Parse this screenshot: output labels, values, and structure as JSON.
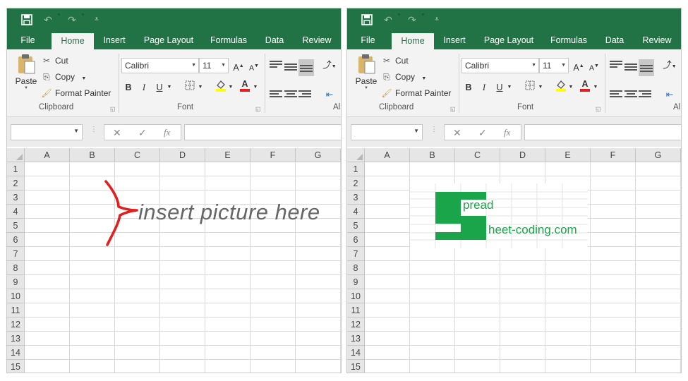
{
  "ribbon": {
    "tabs": [
      "File",
      "Home",
      "Insert",
      "Page Layout",
      "Formulas",
      "Data",
      "Review"
    ],
    "active_tab": "Home",
    "clipboard": {
      "paste": "Paste",
      "cut": "Cut",
      "copy": "Copy",
      "format_painter": "Format Painter",
      "group_label": "Clipboard"
    },
    "font": {
      "name": "Calibri",
      "size": "11",
      "group_label": "Font",
      "bold": "B",
      "italic": "I",
      "underline": "U",
      "grow": "A",
      "shrink": "A",
      "color": "A"
    },
    "alignment": {
      "group_label": "Ali"
    }
  },
  "formula_bar": {
    "fx": "fx"
  },
  "grid": {
    "columns": [
      "A",
      "B",
      "C",
      "D",
      "E",
      "F",
      "G"
    ],
    "rows": [
      "1",
      "2",
      "3",
      "4",
      "5",
      "6",
      "7",
      "8",
      "9",
      "10",
      "11",
      "12",
      "13",
      "14",
      "15"
    ]
  },
  "left_pane": {
    "annotation": "insert picture here"
  },
  "right_pane": {
    "picture": {
      "line1": "pread",
      "line2": "heet-coding.com"
    }
  },
  "colors": {
    "excel_green": "#217346",
    "logo_green": "#1aa54a",
    "arrow_red": "#e31e1e"
  }
}
